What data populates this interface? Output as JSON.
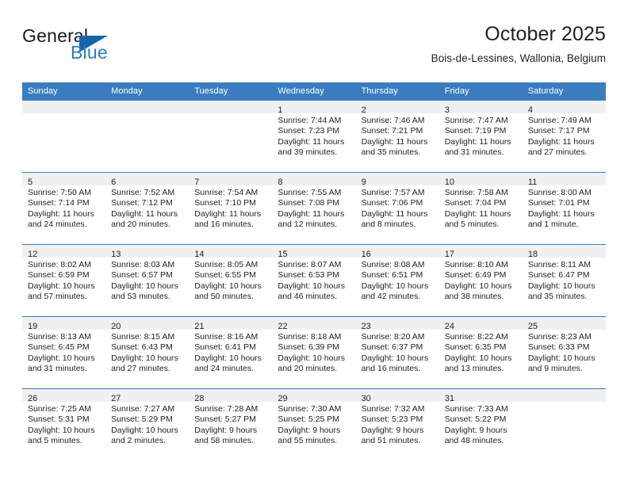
{
  "brand": {
    "line1": "General",
    "line2": "Blue",
    "triangle_icon": "blue-triangle-logo-mark",
    "accent_color": "#2b7cc4"
  },
  "header": {
    "title": "October 2025",
    "subtitle": "Bois-de-Lessines, Wallonia, Belgium"
  },
  "calendar": {
    "header_color": "#3a7cc0",
    "daynum_band_color": "#f0f0f0",
    "weekdays": [
      "Sunday",
      "Monday",
      "Tuesday",
      "Wednesday",
      "Thursday",
      "Friday",
      "Saturday"
    ],
    "weeks": [
      [
        {
          "empty": true
        },
        {
          "empty": true
        },
        {
          "empty": true
        },
        {
          "day": "1",
          "sunrise": "Sunrise: 7:44 AM",
          "sunset": "Sunset: 7:23 PM",
          "daylight": "Daylight: 11 hours and 39 minutes."
        },
        {
          "day": "2",
          "sunrise": "Sunrise: 7:46 AM",
          "sunset": "Sunset: 7:21 PM",
          "daylight": "Daylight: 11 hours and 35 minutes."
        },
        {
          "day": "3",
          "sunrise": "Sunrise: 7:47 AM",
          "sunset": "Sunset: 7:19 PM",
          "daylight": "Daylight: 11 hours and 31 minutes."
        },
        {
          "day": "4",
          "sunrise": "Sunrise: 7:49 AM",
          "sunset": "Sunset: 7:17 PM",
          "daylight": "Daylight: 11 hours and 27 minutes."
        }
      ],
      [
        {
          "day": "5",
          "sunrise": "Sunrise: 7:50 AM",
          "sunset": "Sunset: 7:14 PM",
          "daylight": "Daylight: 11 hours and 24 minutes."
        },
        {
          "day": "6",
          "sunrise": "Sunrise: 7:52 AM",
          "sunset": "Sunset: 7:12 PM",
          "daylight": "Daylight: 11 hours and 20 minutes."
        },
        {
          "day": "7",
          "sunrise": "Sunrise: 7:54 AM",
          "sunset": "Sunset: 7:10 PM",
          "daylight": "Daylight: 11 hours and 16 minutes."
        },
        {
          "day": "8",
          "sunrise": "Sunrise: 7:55 AM",
          "sunset": "Sunset: 7:08 PM",
          "daylight": "Daylight: 11 hours and 12 minutes."
        },
        {
          "day": "9",
          "sunrise": "Sunrise: 7:57 AM",
          "sunset": "Sunset: 7:06 PM",
          "daylight": "Daylight: 11 hours and 8 minutes."
        },
        {
          "day": "10",
          "sunrise": "Sunrise: 7:58 AM",
          "sunset": "Sunset: 7:04 PM",
          "daylight": "Daylight: 11 hours and 5 minutes."
        },
        {
          "day": "11",
          "sunrise": "Sunrise: 8:00 AM",
          "sunset": "Sunset: 7:01 PM",
          "daylight": "Daylight: 11 hours and 1 minute."
        }
      ],
      [
        {
          "day": "12",
          "sunrise": "Sunrise: 8:02 AM",
          "sunset": "Sunset: 6:59 PM",
          "daylight": "Daylight: 10 hours and 57 minutes."
        },
        {
          "day": "13",
          "sunrise": "Sunrise: 8:03 AM",
          "sunset": "Sunset: 6:57 PM",
          "daylight": "Daylight: 10 hours and 53 minutes."
        },
        {
          "day": "14",
          "sunrise": "Sunrise: 8:05 AM",
          "sunset": "Sunset: 6:55 PM",
          "daylight": "Daylight: 10 hours and 50 minutes."
        },
        {
          "day": "15",
          "sunrise": "Sunrise: 8:07 AM",
          "sunset": "Sunset: 6:53 PM",
          "daylight": "Daylight: 10 hours and 46 minutes."
        },
        {
          "day": "16",
          "sunrise": "Sunrise: 8:08 AM",
          "sunset": "Sunset: 6:51 PM",
          "daylight": "Daylight: 10 hours and 42 minutes."
        },
        {
          "day": "17",
          "sunrise": "Sunrise: 8:10 AM",
          "sunset": "Sunset: 6:49 PM",
          "daylight": "Daylight: 10 hours and 38 minutes."
        },
        {
          "day": "18",
          "sunrise": "Sunrise: 8:11 AM",
          "sunset": "Sunset: 6:47 PM",
          "daylight": "Daylight: 10 hours and 35 minutes."
        }
      ],
      [
        {
          "day": "19",
          "sunrise": "Sunrise: 8:13 AM",
          "sunset": "Sunset: 6:45 PM",
          "daylight": "Daylight: 10 hours and 31 minutes."
        },
        {
          "day": "20",
          "sunrise": "Sunrise: 8:15 AM",
          "sunset": "Sunset: 6:43 PM",
          "daylight": "Daylight: 10 hours and 27 minutes."
        },
        {
          "day": "21",
          "sunrise": "Sunrise: 8:16 AM",
          "sunset": "Sunset: 6:41 PM",
          "daylight": "Daylight: 10 hours and 24 minutes."
        },
        {
          "day": "22",
          "sunrise": "Sunrise: 8:18 AM",
          "sunset": "Sunset: 6:39 PM",
          "daylight": "Daylight: 10 hours and 20 minutes."
        },
        {
          "day": "23",
          "sunrise": "Sunrise: 8:20 AM",
          "sunset": "Sunset: 6:37 PM",
          "daylight": "Daylight: 10 hours and 16 minutes."
        },
        {
          "day": "24",
          "sunrise": "Sunrise: 8:22 AM",
          "sunset": "Sunset: 6:35 PM",
          "daylight": "Daylight: 10 hours and 13 minutes."
        },
        {
          "day": "25",
          "sunrise": "Sunrise: 8:23 AM",
          "sunset": "Sunset: 6:33 PM",
          "daylight": "Daylight: 10 hours and 9 minutes."
        }
      ],
      [
        {
          "day": "26",
          "sunrise": "Sunrise: 7:25 AM",
          "sunset": "Sunset: 5:31 PM",
          "daylight": "Daylight: 10 hours and 5 minutes."
        },
        {
          "day": "27",
          "sunrise": "Sunrise: 7:27 AM",
          "sunset": "Sunset: 5:29 PM",
          "daylight": "Daylight: 10 hours and 2 minutes."
        },
        {
          "day": "28",
          "sunrise": "Sunrise: 7:28 AM",
          "sunset": "Sunset: 5:27 PM",
          "daylight": "Daylight: 9 hours and 58 minutes."
        },
        {
          "day": "29",
          "sunrise": "Sunrise: 7:30 AM",
          "sunset": "Sunset: 5:25 PM",
          "daylight": "Daylight: 9 hours and 55 minutes."
        },
        {
          "day": "30",
          "sunrise": "Sunrise: 7:32 AM",
          "sunset": "Sunset: 5:23 PM",
          "daylight": "Daylight: 9 hours and 51 minutes."
        },
        {
          "day": "31",
          "sunrise": "Sunrise: 7:33 AM",
          "sunset": "Sunset: 5:22 PM",
          "daylight": "Daylight: 9 hours and 48 minutes."
        },
        {
          "empty": true
        }
      ]
    ]
  }
}
